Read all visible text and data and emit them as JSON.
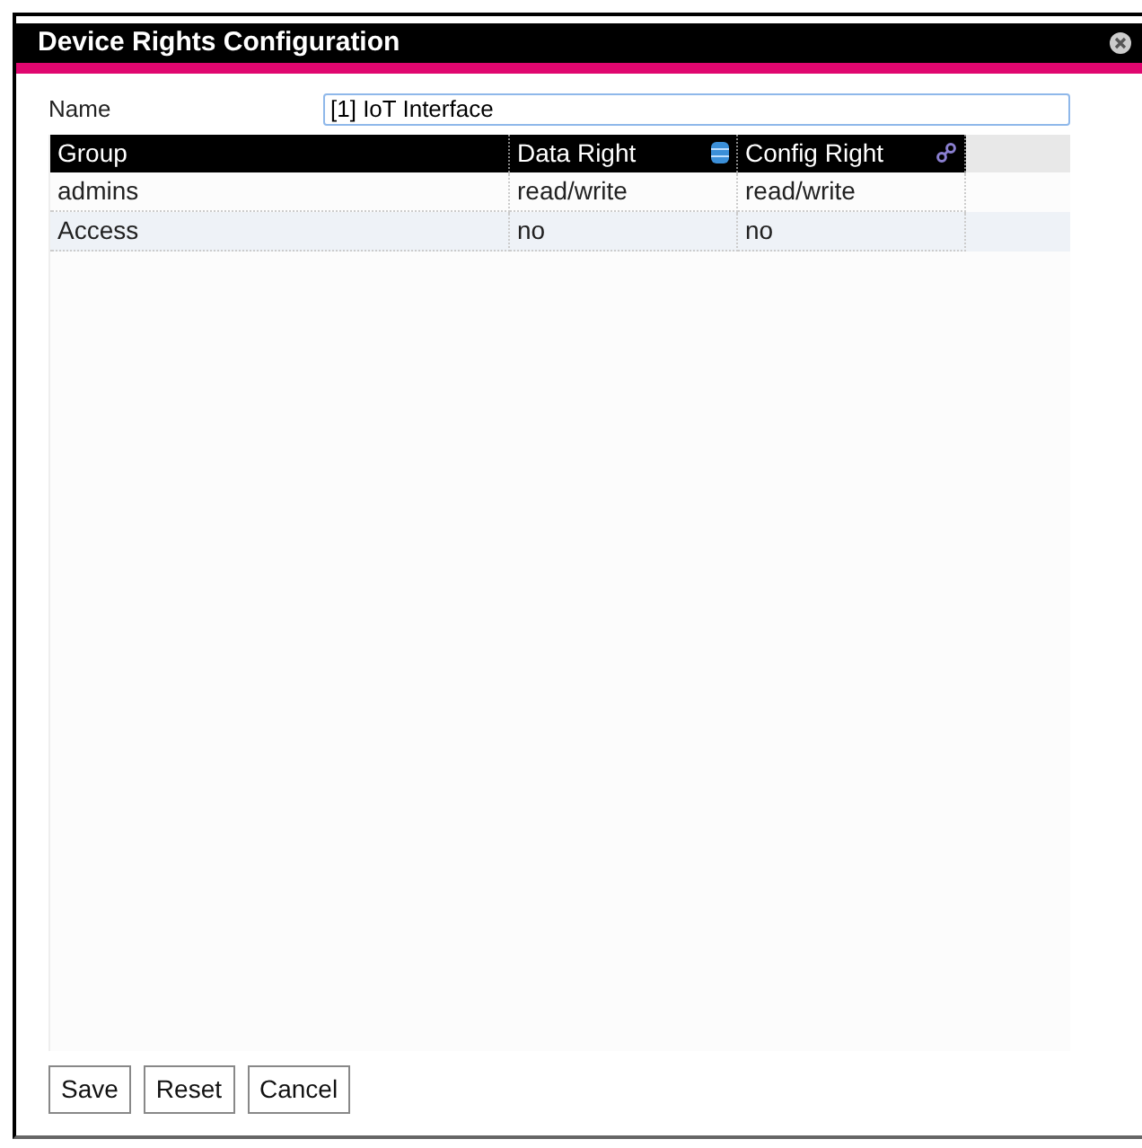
{
  "window": {
    "title": "Device Rights Configuration"
  },
  "name_field": {
    "label": "Name",
    "value": "[1] IoT Interface"
  },
  "table": {
    "columns": [
      {
        "label": "Group",
        "kind": "plain"
      },
      {
        "label": "Data Right",
        "kind": "data"
      },
      {
        "label": "Config Right",
        "kind": "config"
      }
    ],
    "rows": [
      [
        "admins",
        "read/write",
        "read/write"
      ],
      [
        "Access",
        "no",
        "no"
      ]
    ]
  },
  "buttons": [
    "Save",
    "Reset",
    "Cancel"
  ]
}
